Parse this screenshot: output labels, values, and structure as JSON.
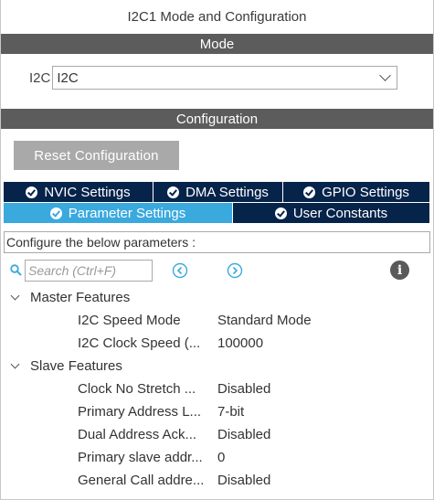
{
  "window": {
    "title": "I2C1 Mode and Configuration"
  },
  "mode_section": {
    "header": "Mode",
    "field_label": "I2C",
    "field_value": "I2C"
  },
  "configuration_section": {
    "header": "Configuration",
    "reset_button": "Reset Configuration",
    "tabs_row1": [
      {
        "label": "NVIC Settings",
        "active": false
      },
      {
        "label": "DMA Settings",
        "active": false
      },
      {
        "label": "GPIO Settings",
        "active": false
      }
    ],
    "tabs_row2": [
      {
        "label": "Parameter Settings",
        "active": true
      },
      {
        "label": "User Constants",
        "active": false
      }
    ],
    "configure_text": "Configure the below parameters :",
    "search_placeholder": "Search (Ctrl+F)",
    "groups": [
      {
        "name": "Master Features",
        "params": [
          {
            "name": "I2C Speed Mode",
            "value": "Standard Mode"
          },
          {
            "name": "I2C Clock Speed (...",
            "value": "100000"
          }
        ]
      },
      {
        "name": "Slave Features",
        "params": [
          {
            "name": "Clock No Stretch ...",
            "value": "Disabled"
          },
          {
            "name": "Primary Address L...",
            "value": "7-bit"
          },
          {
            "name": "Dual Address Ack...",
            "value": "Disabled"
          },
          {
            "name": "Primary slave addr...",
            "value": "0"
          },
          {
            "name": "General Call addre...",
            "value": "Disabled"
          }
        ]
      }
    ]
  },
  "icons": {
    "search": "search-icon",
    "previous": "chevron-left-circle-icon",
    "next": "chevron-right-circle-icon",
    "info": "info-icon",
    "check": "check-circle-icon",
    "expand": "chevron-down-icon"
  },
  "colors": {
    "section_header_bg": "#5c5c5c",
    "tab_bg": "#06234a",
    "tab_active_bg": "#3aa9de",
    "reset_button_bg": "#a9a9a9",
    "accent_icon": "#3aa9de"
  }
}
